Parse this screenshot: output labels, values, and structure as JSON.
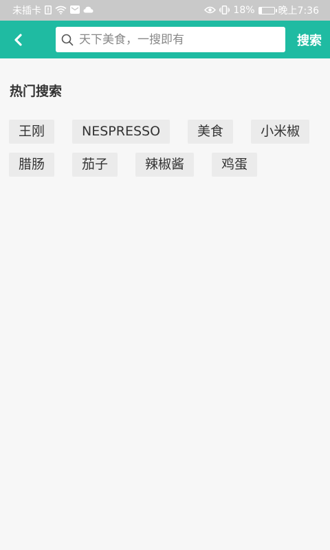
{
  "status_bar": {
    "carrier": "未插卡",
    "battery": "18%",
    "battery_level": 0.18,
    "time": "晚上7:36"
  },
  "header": {
    "search_placeholder": "天下美食，一搜即有",
    "search_button": "搜索"
  },
  "hot_search": {
    "title": "热门搜索",
    "tags": [
      "王刚",
      "NESPRESSO",
      "美食",
      "小米椒",
      "腊肠",
      "茄子",
      "辣椒酱",
      "鸡蛋"
    ]
  },
  "colors": {
    "accent": "#1fbba2",
    "background": "#f7f7f7",
    "tag_background": "#ebebeb"
  }
}
